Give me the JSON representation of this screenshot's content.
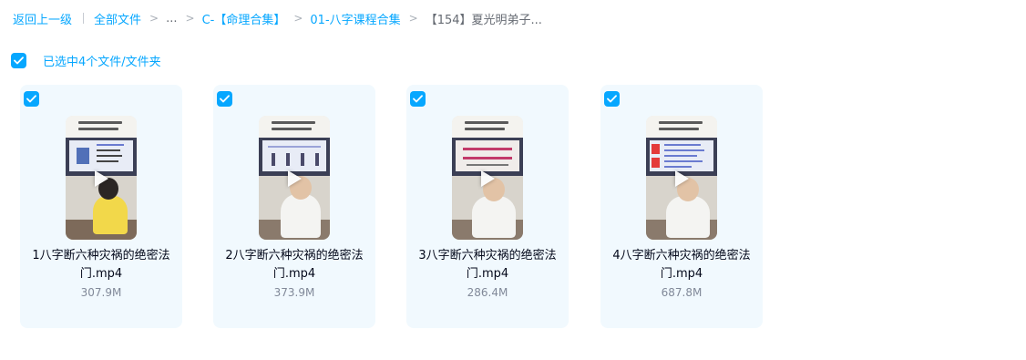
{
  "breadcrumb": {
    "back_label": "返回上一级",
    "items": [
      "全部文件",
      "...",
      "C-【命理合集】",
      "01-八字课程合集"
    ],
    "current": "【154】夏光明弟子..."
  },
  "selection": {
    "status_text": "已选中4个文件/文件夹"
  },
  "files": [
    {
      "name_line1": "1八字断六种灾祸的绝密法",
      "name_line2": "门.mp4",
      "size": "307.9M"
    },
    {
      "name_line1": "2八字断六种灾祸的绝密法",
      "name_line2": "门.mp4",
      "size": "373.9M"
    },
    {
      "name_line1": "3八字断六种灾祸的绝密法",
      "name_line2": "门.mp4",
      "size": "286.4M"
    },
    {
      "name_line1": "4八字断六种灾祸的绝密法",
      "name_line2": "门.mp4",
      "size": "687.8M"
    }
  ],
  "colors": {
    "accent": "#06a7ff",
    "card_bg": "#f1f9fe",
    "text_primary": "#03081a",
    "text_secondary": "#818999"
  },
  "icons": {
    "checkbox": "checkmark-icon",
    "play": "play-icon",
    "separator": "chevron-right-icon"
  }
}
